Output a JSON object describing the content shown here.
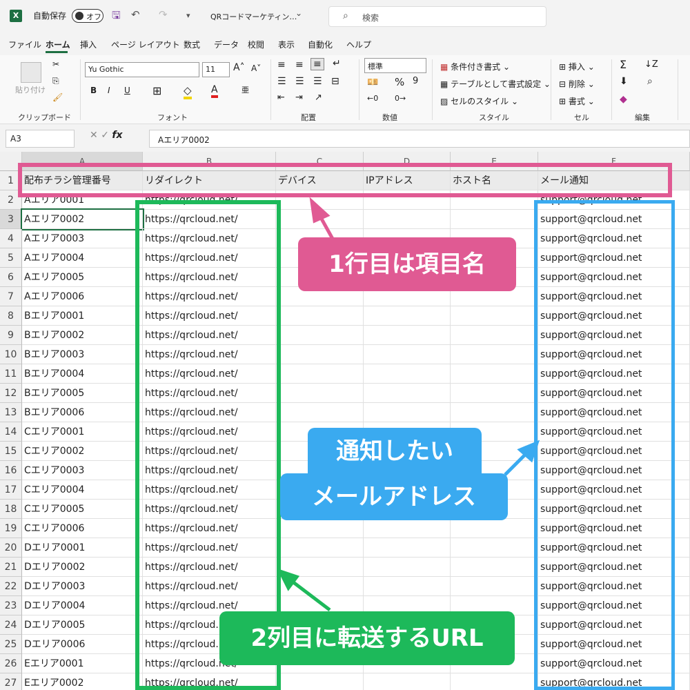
{
  "titlebar": {
    "app_icon": "X",
    "autosave_label": "自動保存",
    "autosave_state": "オフ",
    "doc_title": "QRコードマーケティン…",
    "search_placeholder": "検索"
  },
  "menu": {
    "tabs": [
      "ファイル",
      "ホーム",
      "挿入",
      "ページ レイアウト",
      "数式",
      "データ",
      "校閲",
      "表示",
      "自動化",
      "ヘルプ"
    ],
    "active": "ホーム"
  },
  "ribbon": {
    "clipboard": {
      "paste": "貼り付け",
      "label": "クリップボード"
    },
    "font": {
      "name": "Yu Gothic",
      "size": "11",
      "label": "フォント",
      "bold": "B",
      "italic": "I",
      "underline": "U"
    },
    "alignment": {
      "label": "配置"
    },
    "number": {
      "format": "標準",
      "percent": "%",
      "label": "数値"
    },
    "styles": {
      "conditional": "条件付き書式",
      "table": "テーブルとして書式設定",
      "cell": "セルのスタイル",
      "label": "スタイル"
    },
    "cells": {
      "insert": "挿入",
      "delete": "削除",
      "format": "書式",
      "label": "セル"
    },
    "edit": {
      "label": "編集"
    }
  },
  "formula_bar": {
    "name_box": "A3",
    "fx": "fx",
    "value": "Aエリア0002"
  },
  "sheet": {
    "columns": [
      "A",
      "B",
      "C",
      "D",
      "E",
      "F"
    ],
    "header_row": [
      "配布チラシ管理番号",
      "リダイレクト",
      "デバイス",
      "IPアドレス",
      "ホスト名",
      "メール通知"
    ],
    "rows": [
      {
        "n": "2",
        "a": "Aエリア0001",
        "b": "https://qrcloud.net/",
        "f": "support@qrcloud.net"
      },
      {
        "n": "3",
        "a": "Aエリア0002",
        "b": "https://qrcloud.net/",
        "f": "support@qrcloud.net"
      },
      {
        "n": "4",
        "a": "Aエリア0003",
        "b": "https://qrcloud.net/",
        "f": "support@qrcloud.net"
      },
      {
        "n": "5",
        "a": "Aエリア0004",
        "b": "https://qrcloud.net/",
        "f": "support@qrcloud.net"
      },
      {
        "n": "6",
        "a": "Aエリア0005",
        "b": "https://qrcloud.net/",
        "f": "support@qrcloud.net"
      },
      {
        "n": "7",
        "a": "Aエリア0006",
        "b": "https://qrcloud.net/",
        "f": "support@qrcloud.net"
      },
      {
        "n": "8",
        "a": "Bエリア0001",
        "b": "https://qrcloud.net/",
        "f": "support@qrcloud.net"
      },
      {
        "n": "9",
        "a": "Bエリア0002",
        "b": "https://qrcloud.net/",
        "f": "support@qrcloud.net"
      },
      {
        "n": "10",
        "a": "Bエリア0003",
        "b": "https://qrcloud.net/",
        "f": "support@qrcloud.net"
      },
      {
        "n": "11",
        "a": "Bエリア0004",
        "b": "https://qrcloud.net/",
        "f": "support@qrcloud.net"
      },
      {
        "n": "12",
        "a": "Bエリア0005",
        "b": "https://qrcloud.net/",
        "f": "support@qrcloud.net"
      },
      {
        "n": "13",
        "a": "Bエリア0006",
        "b": "https://qrcloud.net/",
        "f": "support@qrcloud.net"
      },
      {
        "n": "14",
        "a": "Cエリア0001",
        "b": "https://qrcloud.net/",
        "f": "support@qrcloud.net"
      },
      {
        "n": "15",
        "a": "Cエリア0002",
        "b": "https://qrcloud.net/",
        "f": "support@qrcloud.net"
      },
      {
        "n": "16",
        "a": "Cエリア0003",
        "b": "https://qrcloud.net/",
        "f": "support@qrcloud.net"
      },
      {
        "n": "17",
        "a": "Cエリア0004",
        "b": "https://qrcloud.net/",
        "f": "support@qrcloud.net"
      },
      {
        "n": "18",
        "a": "Cエリア0005",
        "b": "https://qrcloud.net/",
        "f": "support@qrcloud.net"
      },
      {
        "n": "19",
        "a": "Cエリア0006",
        "b": "https://qrcloud.net/",
        "f": "support@qrcloud.net"
      },
      {
        "n": "20",
        "a": "Dエリア0001",
        "b": "https://qrcloud.net/",
        "f": "support@qrcloud.net"
      },
      {
        "n": "21",
        "a": "Dエリア0002",
        "b": "https://qrcloud.net/",
        "f": "support@qrcloud.net"
      },
      {
        "n": "22",
        "a": "Dエリア0003",
        "b": "https://qrcloud.net/",
        "f": "support@qrcloud.net"
      },
      {
        "n": "23",
        "a": "Dエリア0004",
        "b": "https://qrcloud.net/",
        "f": "support@qrcloud.net"
      },
      {
        "n": "24",
        "a": "Dエリア0005",
        "b": "https://qrcloud.net/",
        "f": "support@qrcloud.net"
      },
      {
        "n": "25",
        "a": "Dエリア0006",
        "b": "https://qrcloud.net/",
        "f": "support@qrcloud.net"
      },
      {
        "n": "26",
        "a": "Eエリア0001",
        "b": "https://qrcloud.net/",
        "f": "support@qrcloud.net"
      },
      {
        "n": "27",
        "a": "Eエリア0002",
        "b": "https://qrcloud.net/",
        "f": "support@qrcloud.net"
      }
    ]
  },
  "annotations": {
    "pink": {
      "text": "1行目は項目名",
      "color": "#e05a93"
    },
    "blue": {
      "text_line1": "通知したい",
      "text_line2": "メールアドレス",
      "color": "#3aaaf0"
    },
    "green": {
      "text": "2列目に転送するURL",
      "color": "#1db95a"
    }
  }
}
